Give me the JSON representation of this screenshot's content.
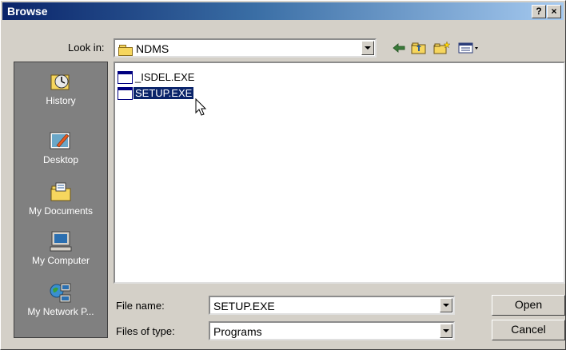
{
  "window": {
    "title": "Browse",
    "help_label": "?",
    "close_label": "×"
  },
  "lookin": {
    "label": "Look in:",
    "value": "NDMS"
  },
  "toolbar": {
    "back_icon": "back-arrow-icon",
    "up_icon": "up-folder-icon",
    "new_folder_icon": "new-folder-icon",
    "view_icon": "view-menu-icon"
  },
  "places": [
    {
      "label": "History",
      "icon": "history-icon"
    },
    {
      "label": "Desktop",
      "icon": "desktop-icon"
    },
    {
      "label": "My Documents",
      "icon": "my-documents-icon"
    },
    {
      "label": "My Computer",
      "icon": "my-computer-icon"
    },
    {
      "label": "My Network P...",
      "icon": "my-network-places-icon"
    }
  ],
  "files": [
    {
      "name": "_ISDEL.EXE",
      "selected": false
    },
    {
      "name": "SETUP.EXE",
      "selected": true
    }
  ],
  "filename": {
    "label": "File name:",
    "value": "SETUP.EXE"
  },
  "filetype": {
    "label": "Files of type:",
    "value": "Programs"
  },
  "buttons": {
    "open": "Open",
    "cancel": "Cancel"
  },
  "colors": {
    "selection": "#0a246a",
    "face": "#d4d0c8",
    "places_bg": "#808080"
  }
}
